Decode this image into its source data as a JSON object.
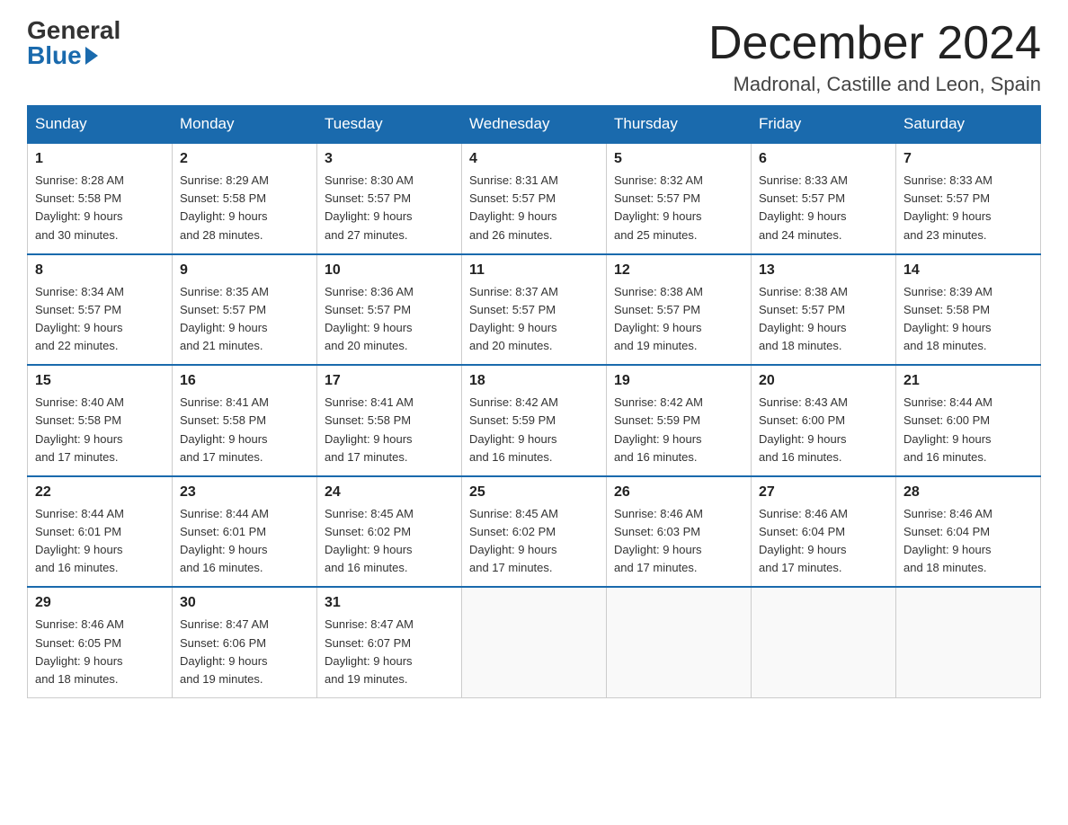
{
  "logo": {
    "general": "General",
    "blue": "Blue"
  },
  "title": "December 2024",
  "location": "Madronal, Castille and Leon, Spain",
  "weekdays": [
    "Sunday",
    "Monday",
    "Tuesday",
    "Wednesday",
    "Thursday",
    "Friday",
    "Saturday"
  ],
  "weeks": [
    [
      {
        "day": "1",
        "sunrise": "8:28 AM",
        "sunset": "5:58 PM",
        "daylight": "9 hours and 30 minutes."
      },
      {
        "day": "2",
        "sunrise": "8:29 AM",
        "sunset": "5:58 PM",
        "daylight": "9 hours and 28 minutes."
      },
      {
        "day": "3",
        "sunrise": "8:30 AM",
        "sunset": "5:57 PM",
        "daylight": "9 hours and 27 minutes."
      },
      {
        "day": "4",
        "sunrise": "8:31 AM",
        "sunset": "5:57 PM",
        "daylight": "9 hours and 26 minutes."
      },
      {
        "day": "5",
        "sunrise": "8:32 AM",
        "sunset": "5:57 PM",
        "daylight": "9 hours and 25 minutes."
      },
      {
        "day": "6",
        "sunrise": "8:33 AM",
        "sunset": "5:57 PM",
        "daylight": "9 hours and 24 minutes."
      },
      {
        "day": "7",
        "sunrise": "8:33 AM",
        "sunset": "5:57 PM",
        "daylight": "9 hours and 23 minutes."
      }
    ],
    [
      {
        "day": "8",
        "sunrise": "8:34 AM",
        "sunset": "5:57 PM",
        "daylight": "9 hours and 22 minutes."
      },
      {
        "day": "9",
        "sunrise": "8:35 AM",
        "sunset": "5:57 PM",
        "daylight": "9 hours and 21 minutes."
      },
      {
        "day": "10",
        "sunrise": "8:36 AM",
        "sunset": "5:57 PM",
        "daylight": "9 hours and 20 minutes."
      },
      {
        "day": "11",
        "sunrise": "8:37 AM",
        "sunset": "5:57 PM",
        "daylight": "9 hours and 20 minutes."
      },
      {
        "day": "12",
        "sunrise": "8:38 AM",
        "sunset": "5:57 PM",
        "daylight": "9 hours and 19 minutes."
      },
      {
        "day": "13",
        "sunrise": "8:38 AM",
        "sunset": "5:57 PM",
        "daylight": "9 hours and 18 minutes."
      },
      {
        "day": "14",
        "sunrise": "8:39 AM",
        "sunset": "5:58 PM",
        "daylight": "9 hours and 18 minutes."
      }
    ],
    [
      {
        "day": "15",
        "sunrise": "8:40 AM",
        "sunset": "5:58 PM",
        "daylight": "9 hours and 17 minutes."
      },
      {
        "day": "16",
        "sunrise": "8:41 AM",
        "sunset": "5:58 PM",
        "daylight": "9 hours and 17 minutes."
      },
      {
        "day": "17",
        "sunrise": "8:41 AM",
        "sunset": "5:58 PM",
        "daylight": "9 hours and 17 minutes."
      },
      {
        "day": "18",
        "sunrise": "8:42 AM",
        "sunset": "5:59 PM",
        "daylight": "9 hours and 16 minutes."
      },
      {
        "day": "19",
        "sunrise": "8:42 AM",
        "sunset": "5:59 PM",
        "daylight": "9 hours and 16 minutes."
      },
      {
        "day": "20",
        "sunrise": "8:43 AM",
        "sunset": "6:00 PM",
        "daylight": "9 hours and 16 minutes."
      },
      {
        "day": "21",
        "sunrise": "8:44 AM",
        "sunset": "6:00 PM",
        "daylight": "9 hours and 16 minutes."
      }
    ],
    [
      {
        "day": "22",
        "sunrise": "8:44 AM",
        "sunset": "6:01 PM",
        "daylight": "9 hours and 16 minutes."
      },
      {
        "day": "23",
        "sunrise": "8:44 AM",
        "sunset": "6:01 PM",
        "daylight": "9 hours and 16 minutes."
      },
      {
        "day": "24",
        "sunrise": "8:45 AM",
        "sunset": "6:02 PM",
        "daylight": "9 hours and 16 minutes."
      },
      {
        "day": "25",
        "sunrise": "8:45 AM",
        "sunset": "6:02 PM",
        "daylight": "9 hours and 17 minutes."
      },
      {
        "day": "26",
        "sunrise": "8:46 AM",
        "sunset": "6:03 PM",
        "daylight": "9 hours and 17 minutes."
      },
      {
        "day": "27",
        "sunrise": "8:46 AM",
        "sunset": "6:04 PM",
        "daylight": "9 hours and 17 minutes."
      },
      {
        "day": "28",
        "sunrise": "8:46 AM",
        "sunset": "6:04 PM",
        "daylight": "9 hours and 18 minutes."
      }
    ],
    [
      {
        "day": "29",
        "sunrise": "8:46 AM",
        "sunset": "6:05 PM",
        "daylight": "9 hours and 18 minutes."
      },
      {
        "day": "30",
        "sunrise": "8:47 AM",
        "sunset": "6:06 PM",
        "daylight": "9 hours and 19 minutes."
      },
      {
        "day": "31",
        "sunrise": "8:47 AM",
        "sunset": "6:07 PM",
        "daylight": "9 hours and 19 minutes."
      },
      null,
      null,
      null,
      null
    ]
  ],
  "labels": {
    "sunrise": "Sunrise:",
    "sunset": "Sunset:",
    "daylight": "Daylight:"
  }
}
